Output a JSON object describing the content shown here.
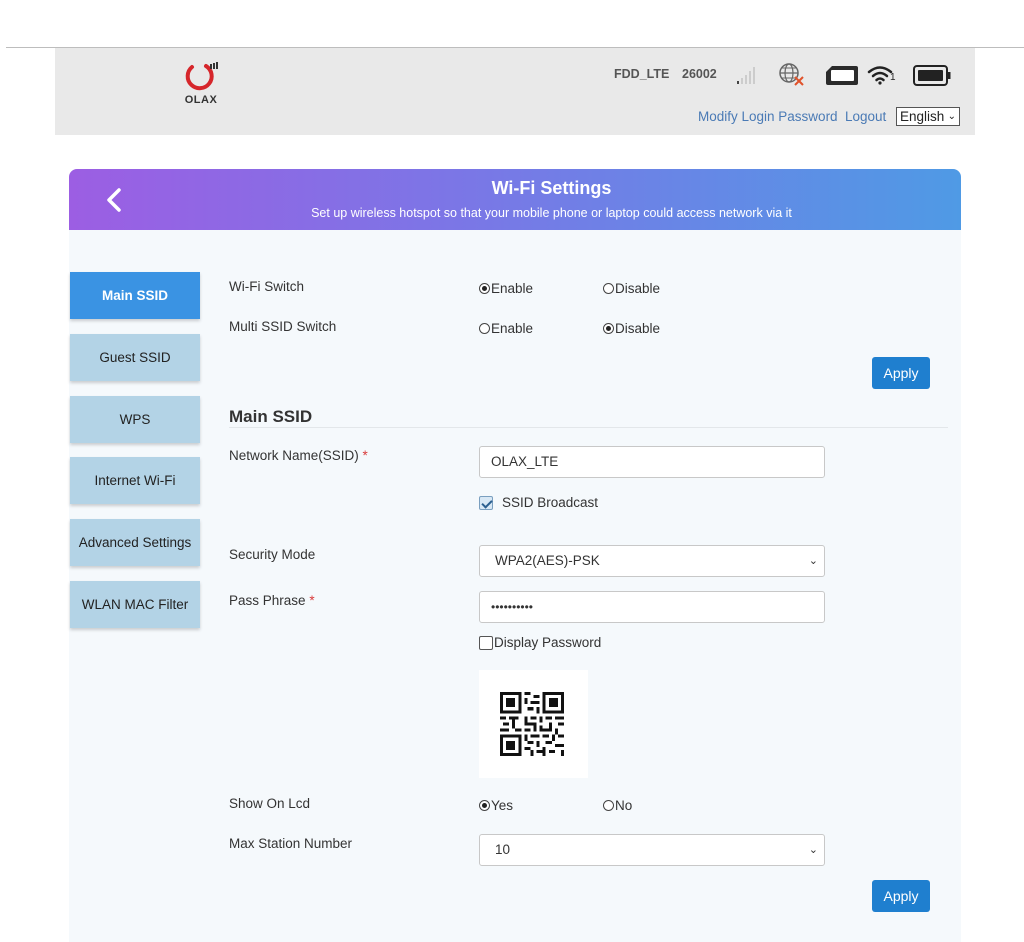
{
  "header": {
    "logo_text": "OLAX",
    "network_type": "FDD_LTE",
    "network_code": "26002",
    "icons": [
      "signal-icon",
      "globe-disconnected-icon",
      "sim-card-icon",
      "wifi-icon",
      "battery-icon"
    ],
    "wifi_clients": "1",
    "modify_password_label": "Modify Login Password",
    "logout_label": "Logout",
    "language": "English"
  },
  "banner": {
    "title": "Wi-Fi Settings",
    "subtitle": "Set up wireless hotspot so that your mobile phone or laptop could access network via it"
  },
  "sidebar": {
    "items": [
      {
        "label": "Main SSID",
        "active": true
      },
      {
        "label": "Guest SSID",
        "active": false
      },
      {
        "label": "WPS",
        "active": false
      },
      {
        "label": "Internet Wi-Fi",
        "active": false
      },
      {
        "label": "Advanced Settings",
        "active": false
      },
      {
        "label": "WLAN MAC Filter",
        "active": false
      }
    ]
  },
  "switches": {
    "wifi_switch": {
      "label": "Wi-Fi Switch",
      "enable": "Enable",
      "disable": "Disable",
      "value": "Enable"
    },
    "multi_ssid_switch": {
      "label": "Multi SSID Switch",
      "enable": "Enable",
      "disable": "Disable",
      "value": "Disable"
    },
    "apply_label": "Apply"
  },
  "main_ssid": {
    "section_title": "Main SSID",
    "network_name_label": "Network Name(SSID)",
    "required_mark": "*",
    "network_name_value": "OLAX_LTE",
    "ssid_broadcast_label": "SSID Broadcast",
    "ssid_broadcast_checked": true,
    "security_mode_label": "Security Mode",
    "security_mode_value": "WPA2(AES)-PSK",
    "pass_phrase_label": "Pass Phrase",
    "pass_phrase_value": "••••••••••",
    "display_password_label": "Display Password",
    "display_password_checked": false,
    "show_on_lcd_label": "Show On Lcd",
    "show_on_lcd_yes": "Yes",
    "show_on_lcd_no": "No",
    "show_on_lcd_value": "Yes",
    "max_station_label": "Max Station Number",
    "max_station_value": "10",
    "apply_label": "Apply"
  },
  "colors": {
    "active_tab": "#3a93e3",
    "inactive_tab": "#b3d3e6",
    "apply_button": "#1f7fcf",
    "logo_red": "#d6262b",
    "link": "#4a7ab5"
  }
}
